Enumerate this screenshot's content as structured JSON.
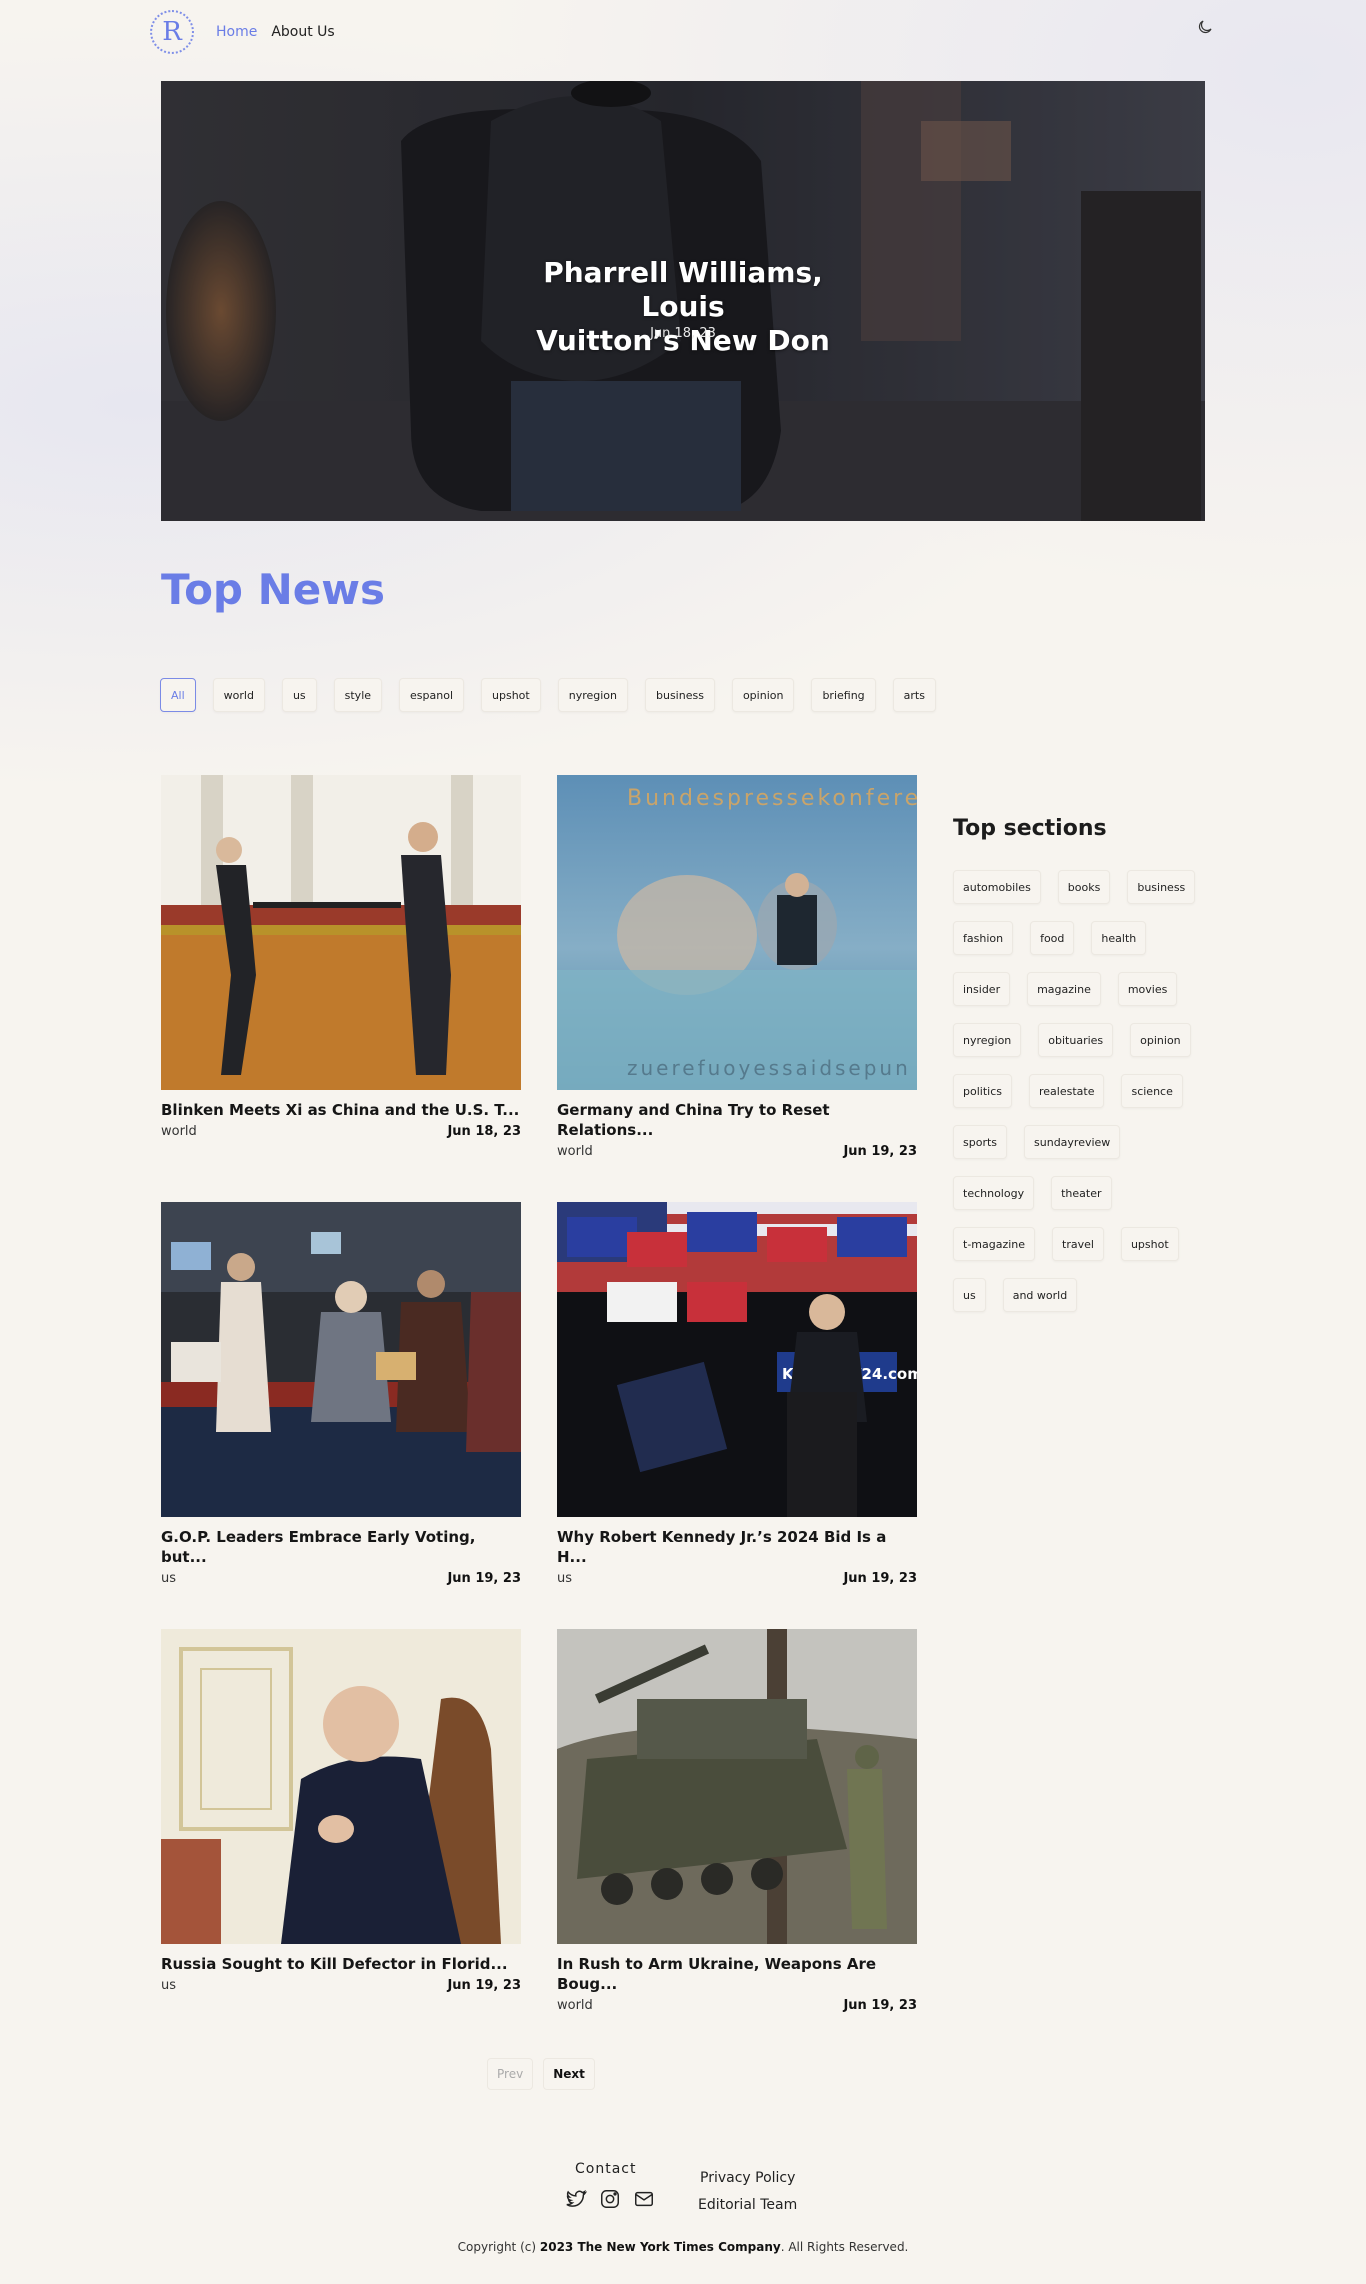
{
  "nav": {
    "logo_letter": "R",
    "links": [
      "Home",
      "About Us"
    ]
  },
  "hero": {
    "title_line1": "Pharrell Williams, Louis",
    "title_line2": "Vuitton’s New Don",
    "date": "Jun 18, 23"
  },
  "top_news": {
    "title": "Top News",
    "filters": [
      "All",
      "world",
      "us",
      "style",
      "espanol",
      "upshot",
      "nyregion",
      "business",
      "opinion",
      "briefing",
      "arts"
    ]
  },
  "articles": [
    {
      "title": "Blinken Meets Xi as China and the U.S. T...",
      "category": "world",
      "date": "Jun 18, 23"
    },
    {
      "title": "Germany and China Try to Reset Relations...",
      "category": "world",
      "date": "Jun 19, 23"
    },
    {
      "title": "G.O.P. Leaders Embrace Early Voting, but...",
      "category": "us",
      "date": "Jun 19, 23"
    },
    {
      "title": "Why Robert Kennedy Jr.’s 2024 Bid Is a H...",
      "category": "us",
      "date": "Jun 19, 23"
    },
    {
      "title": "Russia Sought to Kill Defector in Florid...",
      "category": "us",
      "date": "Jun 19, 23"
    },
    {
      "title": "In Rush to Arm Ukraine, Weapons Are Boug...",
      "category": "world",
      "date": "Jun 19, 23"
    }
  ],
  "sidebar": {
    "title": "Top sections",
    "sections": [
      "automobiles",
      "books",
      "business",
      "fashion",
      "food",
      "health",
      "insider",
      "magazine",
      "movies",
      "nyregion",
      "obituaries",
      "opinion",
      "politics",
      "realestate",
      "science",
      "sports",
      "sundayreview",
      "technology",
      "theater",
      "t-magazine",
      "travel",
      "upshot",
      "us",
      "and world"
    ]
  },
  "pagination": {
    "prev": "Prev",
    "next": "Next"
  },
  "footer": {
    "contact_label": "Contact",
    "links": [
      "Privacy Policy",
      "Editorial Team"
    ],
    "copyright_prefix": "Copyright (c)",
    "copyright_bold": "2023 The New York Times Company",
    "copyright_suffix": ". All Rights Reserved."
  },
  "colors": {
    "accent": "#6a7de6",
    "background": "#f7f4ef"
  }
}
